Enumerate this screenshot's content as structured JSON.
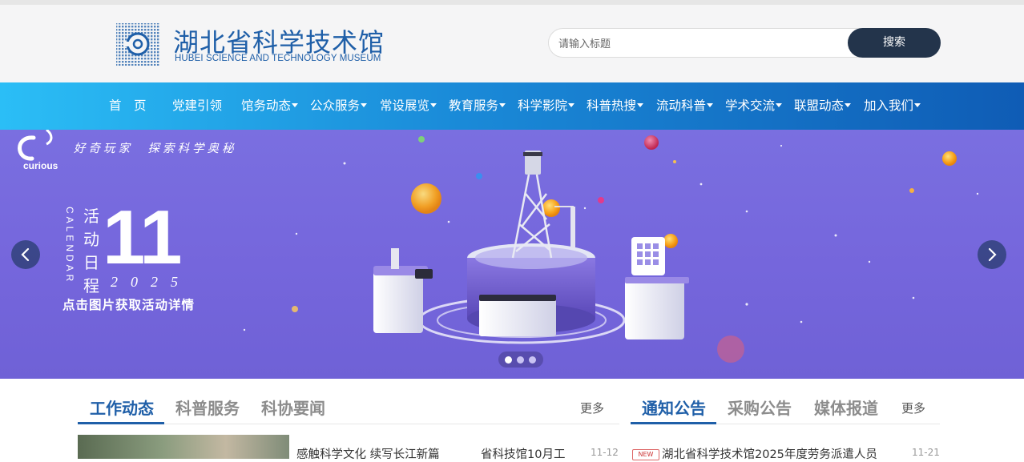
{
  "header": {
    "logo_cn": "湖北省科学技术馆",
    "logo_en": "HUBEI SCIENCE AND TECHNOLOGY MUSEUM",
    "search_placeholder": "请输入标题",
    "search_button": "搜索"
  },
  "nav": {
    "items": [
      {
        "label": "首　页",
        "dropdown": false
      },
      {
        "label": "党建引领",
        "dropdown": false
      },
      {
        "label": "馆务动态",
        "dropdown": true
      },
      {
        "label": "公众服务",
        "dropdown": true
      },
      {
        "label": "常设展览",
        "dropdown": true
      },
      {
        "label": "教育服务",
        "dropdown": true
      },
      {
        "label": "科学影院",
        "dropdown": true
      },
      {
        "label": "科普热搜",
        "dropdown": true
      },
      {
        "label": "流动科普",
        "dropdown": true
      },
      {
        "label": "学术交流",
        "dropdown": true
      },
      {
        "label": "联盟动态",
        "dropdown": true
      },
      {
        "label": "加入我们",
        "dropdown": true
      }
    ]
  },
  "banner": {
    "slogan": "好奇玩家　探索科学奥秘",
    "brand": "curious",
    "vertical_title": "活动日程",
    "vertical_sub": "CALENDAR",
    "month": "11",
    "year": "2025",
    "cta": "点击图片获取活动详情",
    "slide_count": 3,
    "active_slide": 0
  },
  "left_panel": {
    "tabs": [
      "工作动态",
      "科普服务",
      "科协要闻"
    ],
    "active_tab": 0,
    "more": "更多",
    "news": [
      {
        "title": "感触科学文化 续写长江新篇",
        "title2": "省科技馆10月工",
        "date": "11-12"
      }
    ]
  },
  "right_panel": {
    "tabs": [
      "通知公告",
      "采购公告",
      "媒体报道"
    ],
    "active_tab": 0,
    "more": "更多",
    "news": [
      {
        "badge": "NEW",
        "title": "湖北省科学技术馆2025年度劳务派遣人员",
        "date": "11-21"
      }
    ]
  },
  "colors": {
    "brand_blue": "#1f5fa8",
    "search_button": "#23344b",
    "banner_bg": "#7566dc"
  }
}
